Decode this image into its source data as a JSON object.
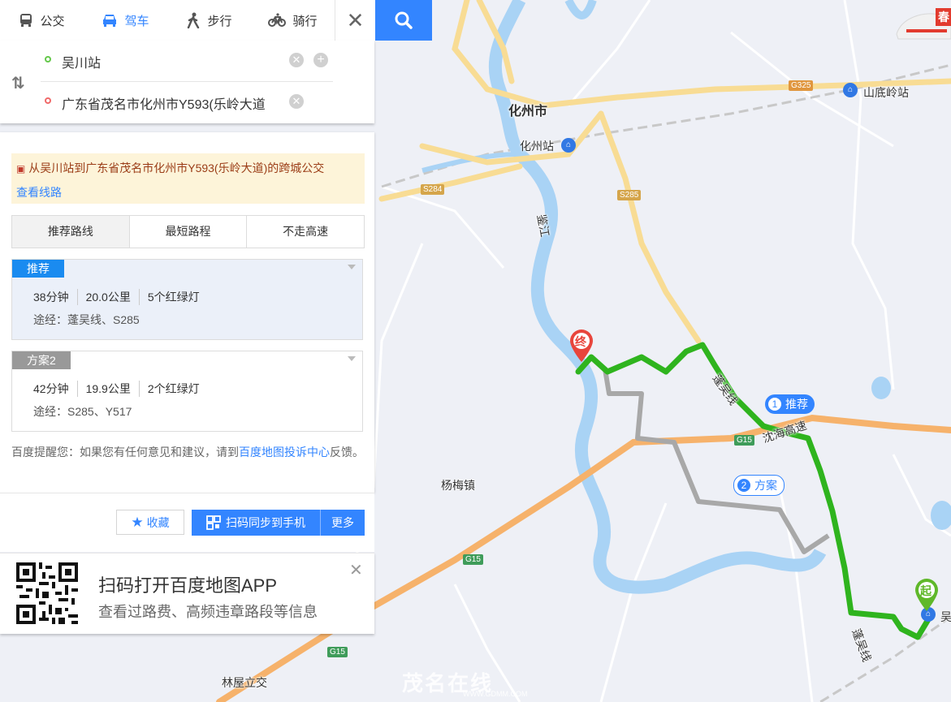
{
  "modes": [
    {
      "label": "公交",
      "icon": "bus-icon",
      "active": false
    },
    {
      "label": "驾车",
      "icon": "car-icon",
      "active": true
    },
    {
      "label": "步行",
      "icon": "walk-icon",
      "active": false
    },
    {
      "label": "骑行",
      "icon": "bike-icon",
      "active": false
    }
  ],
  "route": {
    "start": "吴川站",
    "end": "广东省茂名市化州市Y593(乐岭大道"
  },
  "notice": {
    "text": "从吴川站到广东省茂名市化州市Y593(乐岭大道)的跨城公交",
    "link": "查看线路"
  },
  "options": [
    {
      "label": "推荐路线",
      "active": true
    },
    {
      "label": "最短路程",
      "active": false
    },
    {
      "label": "不走高速",
      "active": false
    }
  ],
  "plans": [
    {
      "tag": "推荐",
      "time": "38分钟",
      "distance": "20.0公里",
      "lights": "5个红绿灯",
      "via": "途经：蓬吴线、S285",
      "color": "#1a8bf0"
    },
    {
      "tag": "方案2",
      "time": "42分钟",
      "distance": "19.9公里",
      "lights": "2个红绿灯",
      "via": "途经：S285、Y517",
      "color": "#999999"
    }
  ],
  "tip": {
    "prefix": "百度提醒您：如果您有任何意见和建议，请到",
    "link": "百度地图投诉中心",
    "suffix": "反馈。"
  },
  "actions": {
    "favorite": "收藏",
    "sync": "扫码同步到手机",
    "more": "更多"
  },
  "app_promo": {
    "title": "扫码打开百度地图APP",
    "subtitle": "查看过路费、高频违章路段等信息"
  },
  "map": {
    "labels": {
      "city": "化州市",
      "station_huazhou": "化州站",
      "station_shandiling": "山底岭站",
      "town_yangmei": "杨梅镇",
      "interchange_linwu": "林屋立交",
      "river": "鉴江",
      "road_penwu_1": "蓬吴线",
      "road_penwu_2": "蓬吴线",
      "expressway": "沈海高速",
      "start_station_partial": "吴"
    },
    "shields": {
      "g325": "G325",
      "s284": "S284",
      "s285": "S285",
      "g15_a": "G15",
      "g15_b": "G15",
      "g15_c": "G15"
    },
    "markers": {
      "end": "终",
      "start": "起",
      "recommended_num": "1",
      "recommended_label": "推荐",
      "alt_num": "2",
      "alt_label": "方案"
    },
    "watermark": "茂名在线",
    "watermark_url": "WWW.GDMM.COM",
    "promo_text": "春",
    "colors": {
      "route_recommended": "#2fb41e",
      "route_alt": "#a8a8a8",
      "river": "#a9d3f5",
      "highway": "#f6b26b",
      "provincial": "#f8dc94"
    }
  }
}
